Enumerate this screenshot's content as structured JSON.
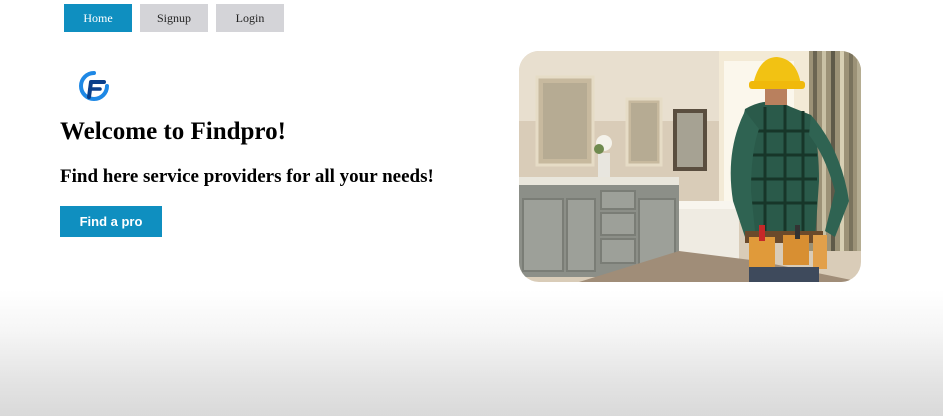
{
  "nav": {
    "home": "Home",
    "signup": "Signup",
    "login": "Login"
  },
  "colors": {
    "accent": "#0f8fc0",
    "nav_inactive": "#d4d4d8",
    "logo_dark": "#0b3f8a",
    "logo_light": "#1e88e5"
  },
  "hero": {
    "title": "Welcome to Findpro!",
    "subtitle": "Find here service providers for all your needs!",
    "cta_label": "Find a pro"
  },
  "icons": {
    "logo": "findpro-logo-icon"
  }
}
